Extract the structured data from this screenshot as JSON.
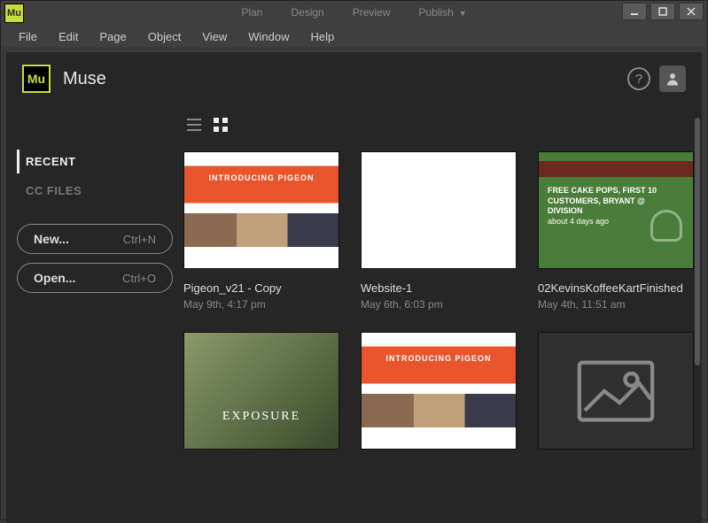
{
  "titlebar": {
    "logo_text": "Mu",
    "modes": [
      "Plan",
      "Design",
      "Preview"
    ],
    "publish_label": "Publish"
  },
  "menubar": [
    "File",
    "Edit",
    "Page",
    "Object",
    "View",
    "Window",
    "Help"
  ],
  "panel": {
    "logo_text": "Mu",
    "app_name": "Muse",
    "help_glyph": "?"
  },
  "sidebar": {
    "tabs": [
      {
        "label": "RECENT",
        "active": true
      },
      {
        "label": "CC FILES",
        "active": false
      }
    ],
    "buttons": [
      {
        "label": "New...",
        "shortcut": "Ctrl+N"
      },
      {
        "label": "Open...",
        "shortcut": "Ctrl+O"
      }
    ]
  },
  "recent": {
    "cards": [
      {
        "title": "Pigeon_v21 - Copy",
        "date": "May 9th, 4:17 pm",
        "thumb_text": "INTRODUCING PIGEON"
      },
      {
        "title": "Website-1",
        "date": "May 6th, 6:03 pm"
      },
      {
        "title": "02KevinsKoffeeKartFinished",
        "date": "May 4th, 11:51 am",
        "promo_line1": "FREE CAKE POPS, FIRST 10",
        "promo_line2": "CUSTOMERS, BRYANT @",
        "promo_line3": "DIVISION",
        "promo_time": "about 4 days ago"
      },
      {
        "thumb_text": "EXPOSURE"
      },
      {
        "thumb_text": "INTRODUCING PIGEON"
      }
    ]
  }
}
